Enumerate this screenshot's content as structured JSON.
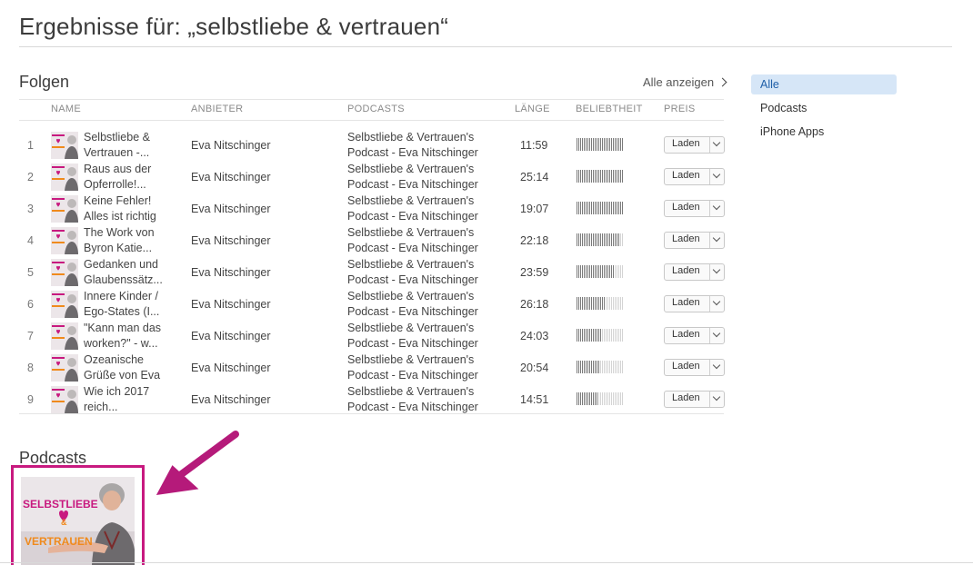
{
  "header": {
    "title": "Ergebnisse für: „selbstliebe & vertrauen“"
  },
  "episodes_section": {
    "title": "Folgen",
    "see_all": "Alle anzeigen",
    "columns": {
      "name": "NAME",
      "provider": "ANBIETER",
      "podcast": "PODCASTS",
      "length": "LÄNGE",
      "popularity": "BELIEBTHEIT",
      "price": "PREIS"
    },
    "rows": [
      {
        "num": "1",
        "name_line1": "Selbstliebe &",
        "name_line2": "Vertrauen -...",
        "provider": "Eva Nitschinger",
        "podcast_line1": "Selbstliebe & Vertrauen's",
        "podcast_line2": "Podcast - Eva Nitschinger",
        "length": "11:59",
        "popularity": 1.0,
        "action": "Laden"
      },
      {
        "num": "2",
        "name_line1": "Raus aus der",
        "name_line2": "Opferrolle!...",
        "provider": "Eva Nitschinger",
        "podcast_line1": "Selbstliebe & Vertrauen's",
        "podcast_line2": "Podcast - Eva Nitschinger",
        "length": "25:14",
        "popularity": 1.0,
        "action": "Laden"
      },
      {
        "num": "3",
        "name_line1": "Keine Fehler!",
        "name_line2": "Alles ist richtig",
        "provider": "Eva Nitschinger",
        "podcast_line1": "Selbstliebe & Vertrauen's",
        "podcast_line2": "Podcast - Eva Nitschinger",
        "length": "19:07",
        "popularity": 1.0,
        "action": "Laden"
      },
      {
        "num": "4",
        "name_line1": "The Work von",
        "name_line2": "Byron Katie...",
        "provider": "Eva Nitschinger",
        "podcast_line1": "Selbstliebe & Vertrauen's",
        "podcast_line2": "Podcast - Eva Nitschinger",
        "length": "22:18",
        "popularity": 0.92,
        "action": "Laden"
      },
      {
        "num": "5",
        "name_line1": "Gedanken und",
        "name_line2": "Glaubenssätz...",
        "provider": "Eva Nitschinger",
        "podcast_line1": "Selbstliebe & Vertrauen's",
        "podcast_line2": "Podcast - Eva Nitschinger",
        "length": "23:59",
        "popularity": 0.8,
        "action": "Laden"
      },
      {
        "num": "6",
        "name_line1": "Innere Kinder /",
        "name_line2": "Ego-States (I...",
        "provider": "Eva Nitschinger",
        "podcast_line1": "Selbstliebe & Vertrauen's",
        "podcast_line2": "Podcast - Eva Nitschinger",
        "length": "26:18",
        "popularity": 0.62,
        "action": "Laden"
      },
      {
        "num": "7",
        "name_line1": "\"Kann man das",
        "name_line2": "worken?\" - w...",
        "provider": "Eva Nitschinger",
        "podcast_line1": "Selbstliebe & Vertrauen's",
        "podcast_line2": "Podcast - Eva Nitschinger",
        "length": "24:03",
        "popularity": 0.55,
        "action": "Laden"
      },
      {
        "num": "8",
        "name_line1": "Ozeanische",
        "name_line2": "Grüße von Eva",
        "provider": "Eva Nitschinger",
        "podcast_line1": "Selbstliebe & Vertrauen's",
        "podcast_line2": "Podcast - Eva Nitschinger",
        "length": "20:54",
        "popularity": 0.5,
        "action": "Laden"
      },
      {
        "num": "9",
        "name_line1": "Wie ich 2017",
        "name_line2": "reich...",
        "provider": "Eva Nitschinger",
        "podcast_line1": "Selbstliebe & Vertrauen's",
        "podcast_line2": "Podcast - Eva Nitschinger",
        "length": "14:51",
        "popularity": 0.48,
        "action": "Laden"
      }
    ]
  },
  "podcasts_section": {
    "title": "Podcasts",
    "cover_text_top": "SELBSTLIEBE",
    "cover_text_mid": "&",
    "cover_text_bottom": "VERTRAUEN"
  },
  "sidebar": {
    "items": [
      {
        "label": "Alle",
        "active": true
      },
      {
        "label": "Podcasts",
        "active": false
      },
      {
        "label": "iPhone Apps",
        "active": false
      }
    ]
  },
  "colors": {
    "highlight": "#c8197f",
    "active_bg": "#d6e6f7",
    "active_text": "#1f5fa8"
  }
}
